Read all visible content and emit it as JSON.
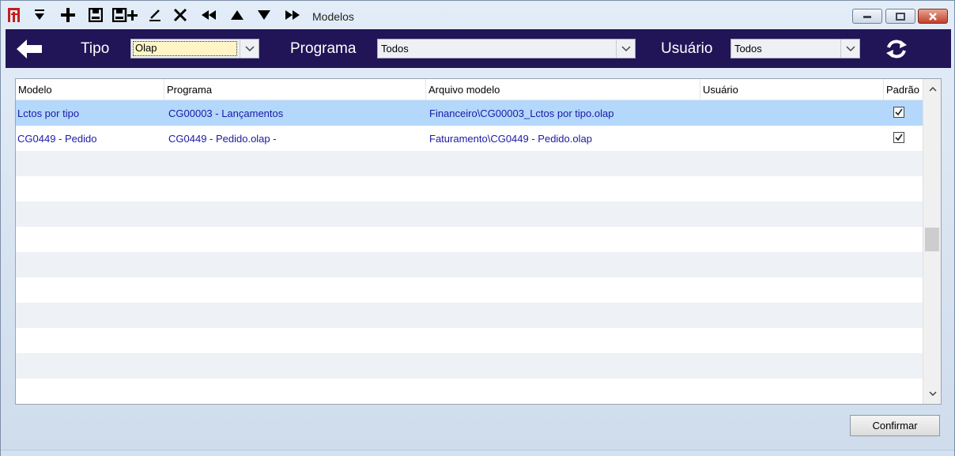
{
  "window": {
    "title": "Modelos"
  },
  "toolbar": {
    "icons": [
      "app-logo-icon",
      "filter-down-icon",
      "add-icon",
      "save-icon",
      "save-new-icon",
      "edit-icon",
      "delete-icon",
      "first-record-icon",
      "previous-record-icon",
      "next-record-icon",
      "last-record-icon"
    ]
  },
  "filters": {
    "tipo_label": "Tipo",
    "tipo_value": "Olap",
    "programa_label": "Programa",
    "programa_value": "Todos",
    "usuario_label": "Usuário",
    "usuario_value": "Todos"
  },
  "grid": {
    "columns": [
      "Modelo",
      "Programa",
      "Arquivo modelo",
      "Usuário",
      "Padrão"
    ],
    "rows": [
      {
        "modelo": "Lctos por tipo",
        "programa": "CG00003 - Lançamentos",
        "arquivo": "Financeiro\\CG00003_Lctos por tipo.olap",
        "usuario": "",
        "padrao": true
      },
      {
        "modelo": "CG0449 - Pedido",
        "programa": "CG0449 - Pedido.olap -",
        "arquivo": "Faturamento\\CG0449 - Pedido.olap",
        "usuario": "",
        "padrao": true
      }
    ]
  },
  "buttons": {
    "confirm_label": "Confirmar"
  },
  "colors": {
    "header_bar": "#211557",
    "selected_row": "#b3d8fb",
    "row_text": "#1a1aa6"
  }
}
